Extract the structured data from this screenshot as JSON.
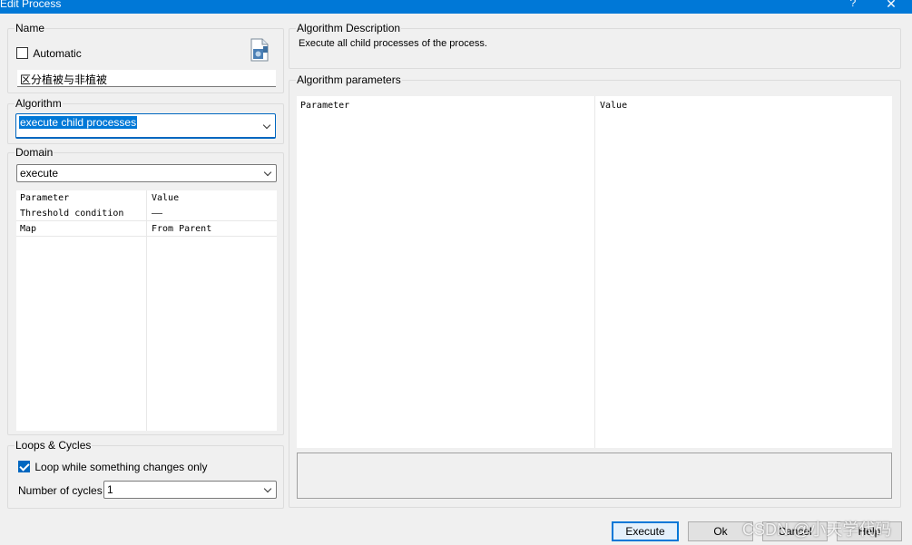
{
  "window": {
    "title": "Edit Process",
    "help_glyph": "?",
    "close_glyph": "✕"
  },
  "name_group": {
    "label": "Name",
    "automatic_label": "Automatic",
    "automatic_checked": false,
    "name_value": "区分植被与非植被"
  },
  "algorithm_group": {
    "label": "Algorithm",
    "selected_value": "execute child processes"
  },
  "domain_group": {
    "label": "Domain",
    "selected_value": "execute",
    "grid": {
      "headers": [
        "Parameter",
        "Value"
      ],
      "rows": [
        {
          "parameter": "Threshold condition",
          "value": "——"
        },
        {
          "parameter": "Map",
          "value": "From Parent"
        }
      ]
    }
  },
  "loops_group": {
    "label": "Loops & Cycles",
    "loop_label": "Loop while something changes only",
    "loop_checked": true,
    "cycles_label": "Number of cycles",
    "cycles_value": "1"
  },
  "description_group": {
    "label": "Algorithm Description",
    "text": "Execute all child processes of the process."
  },
  "parameters_group": {
    "label": "Algorithm parameters",
    "headers": [
      "Parameter",
      "Value"
    ]
  },
  "buttons": {
    "execute": "Execute",
    "ok": "Ok",
    "cancel": "Cancel",
    "help": "Help"
  },
  "watermark": "CSDN @小天学代码",
  "icons": {
    "document_icon": "document-gear-icon",
    "accent": "#0078d7",
    "check_color": "#0067c0"
  }
}
